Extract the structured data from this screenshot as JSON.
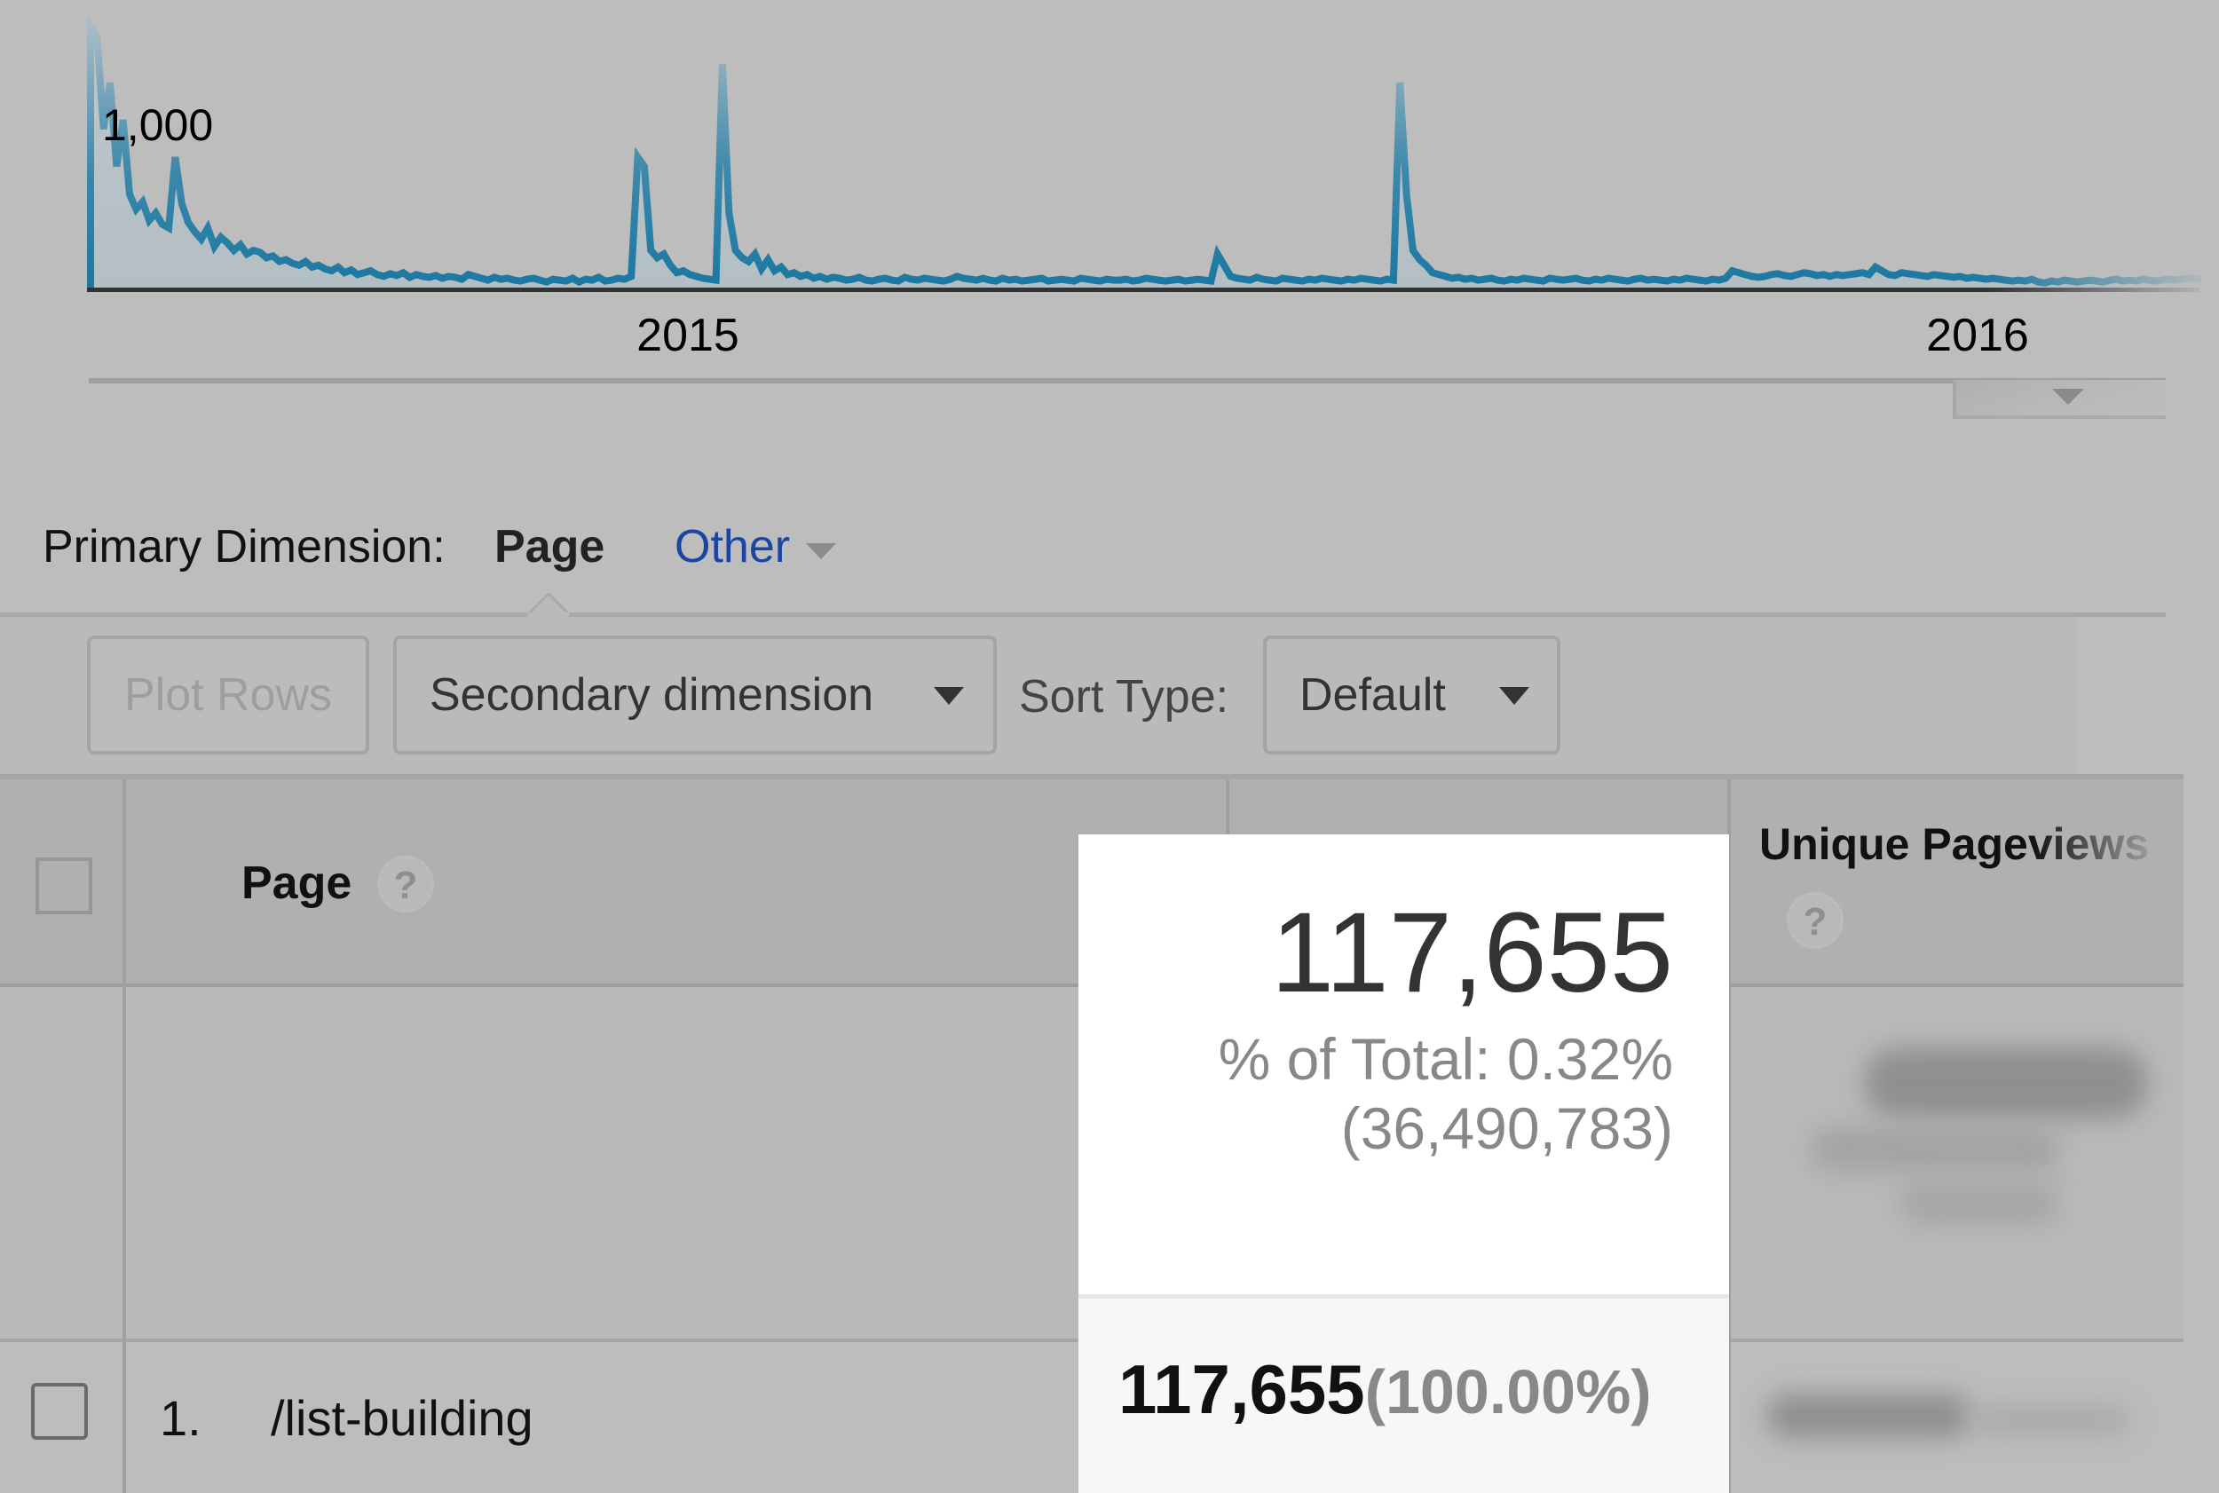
{
  "chart_data": {
    "type": "area",
    "title": "",
    "y_tick_labels": [
      "1,000"
    ],
    "x_tick_labels": [
      "2015",
      "2016"
    ],
    "ylim": [
      0,
      1400
    ],
    "series": [
      {
        "name": "Pageviews",
        "color": "#1f77a0",
        "values": [
          1400,
          1350,
          850,
          1100,
          650,
          900,
          500,
          420,
          460,
          360,
          400,
          340,
          320,
          700,
          450,
          350,
          300,
          260,
          320,
          220,
          270,
          240,
          200,
          230,
          180,
          200,
          190,
          160,
          170,
          140,
          150,
          130,
          120,
          140,
          110,
          120,
          100,
          90,
          110,
          80,
          95,
          70,
          80,
          90,
          70,
          60,
          75,
          65,
          80,
          55,
          70,
          60,
          55,
          65,
          50,
          60,
          55,
          45,
          70,
          60,
          50,
          40,
          55,
          45,
          50,
          40,
          35,
          45,
          50,
          40,
          30,
          45,
          40,
          35,
          50,
          30,
          45,
          40,
          55,
          35,
          40,
          50,
          45,
          60,
          700,
          650,
          200,
          160,
          180,
          120,
          80,
          90,
          70,
          60,
          50,
          45,
          40,
          1200,
          400,
          200,
          160,
          140,
          180,
          100,
          150,
          90,
          110,
          70,
          80,
          60,
          70,
          50,
          60,
          45,
          55,
          50,
          40,
          45,
          55,
          40,
          35,
          45,
          50,
          40,
          35,
          55,
          45,
          40,
          50,
          45,
          40,
          35,
          45,
          60,
          50,
          45,
          40,
          50,
          40,
          35,
          50,
          40,
          45,
          35,
          40,
          45,
          50,
          35,
          40,
          45,
          40,
          35,
          50,
          45,
          40,
          35,
          45,
          40,
          40,
          45,
          35,
          40,
          50,
          45,
          40,
          35,
          40,
          45,
          35,
          40,
          45,
          40,
          35,
          180,
          120,
          60,
          50,
          45,
          40,
          55,
          45,
          40,
          35,
          50,
          45,
          40,
          35,
          45,
          40,
          50,
          45,
          40,
          35,
          45,
          40,
          50,
          45,
          40,
          35,
          45,
          40,
          1100,
          500,
          200,
          150,
          120,
          80,
          70,
          60,
          50,
          55,
          45,
          50,
          40,
          45,
          50,
          40,
          35,
          45,
          40,
          50,
          45,
          40,
          35,
          50,
          45,
          40,
          45,
          50,
          40,
          35,
          45,
          40,
          50,
          45,
          40,
          35,
          45,
          50,
          40,
          45,
          40,
          35,
          45,
          40,
          50,
          45,
          40,
          35,
          45,
          40,
          50,
          90,
          80,
          70,
          60,
          55,
          60,
          70,
          75,
          65,
          60,
          70,
          80,
          75,
          65,
          70,
          60,
          70,
          65,
          70,
          75,
          80,
          70,
          110,
          90,
          70,
          65,
          80,
          75,
          70,
          65,
          60,
          70,
          65,
          60,
          55,
          60,
          50,
          55,
          50,
          45,
          50,
          45,
          40,
          35,
          40,
          35,
          45,
          30,
          25,
          35,
          30,
          40,
          35,
          30,
          35,
          40,
          35,
          30,
          40,
          45,
          35,
          40,
          35,
          45,
          40,
          35,
          40,
          45,
          40,
          45,
          50,
          45,
          40
        ]
      }
    ],
    "xlabel": "",
    "ylabel": "",
    "grid": false,
    "legend": "none"
  },
  "timeline": {
    "handle_icon": "triangle-down-icon"
  },
  "primary_dimension": {
    "label": "Primary Dimension:",
    "selected": "Page",
    "other": "Other"
  },
  "toolbar": {
    "plot_rows": "Plot Rows",
    "secondary_dimension": "Secondary dimension",
    "sort_type_label": "Sort Type:",
    "sort_type_value": "Default"
  },
  "table": {
    "columns": {
      "page": "Page",
      "unique_pageviews": "Unique Pageviews"
    },
    "help_glyph": "?",
    "rows": [
      {
        "index": "1.",
        "page": "/list-building"
      }
    ]
  },
  "highlight": {
    "total": "117,655",
    "pct_of_total": "% of Total: 0.32%",
    "site_total": "(36,490,783)",
    "row_value": "117,655",
    "row_pct": "(100.00%)"
  }
}
